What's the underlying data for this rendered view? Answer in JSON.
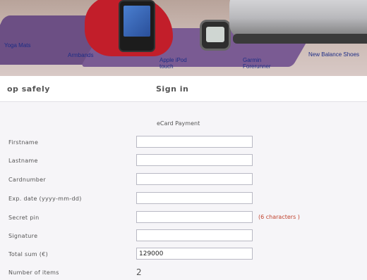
{
  "banner": {
    "labels": {
      "yoga_mats": "Yoga Mats",
      "armbands": "Armbands",
      "apple_ipod": "Apple iPod touch",
      "garmin": "Garmin Forerunner",
      "new_balance": "New Balance Shoes"
    }
  },
  "header": {
    "shop_safely": "op safely",
    "sign_in": "Sign in"
  },
  "form": {
    "title": "eCard Payment",
    "fields": {
      "firstname": {
        "label": "Firstname",
        "value": ""
      },
      "lastname": {
        "label": "Lastname",
        "value": ""
      },
      "cardnumber": {
        "label": "Cardnumber",
        "value": ""
      },
      "exp_date": {
        "label": "Exp. date (yyyy-mm-dd)",
        "value": ""
      },
      "secret_pin": {
        "label": "Secret pin",
        "value": "",
        "hint": "(6 characters )"
      },
      "signature": {
        "label": "Signature",
        "value": ""
      },
      "total_sum": {
        "label": "Total sum (€)",
        "value": "129000"
      },
      "number_of_items": {
        "label": "Number of items",
        "value": "2"
      }
    }
  },
  "colors": {
    "banner_label": "#1d2d86",
    "hint": "#c0432e",
    "input_border": "#b9b9c4"
  }
}
